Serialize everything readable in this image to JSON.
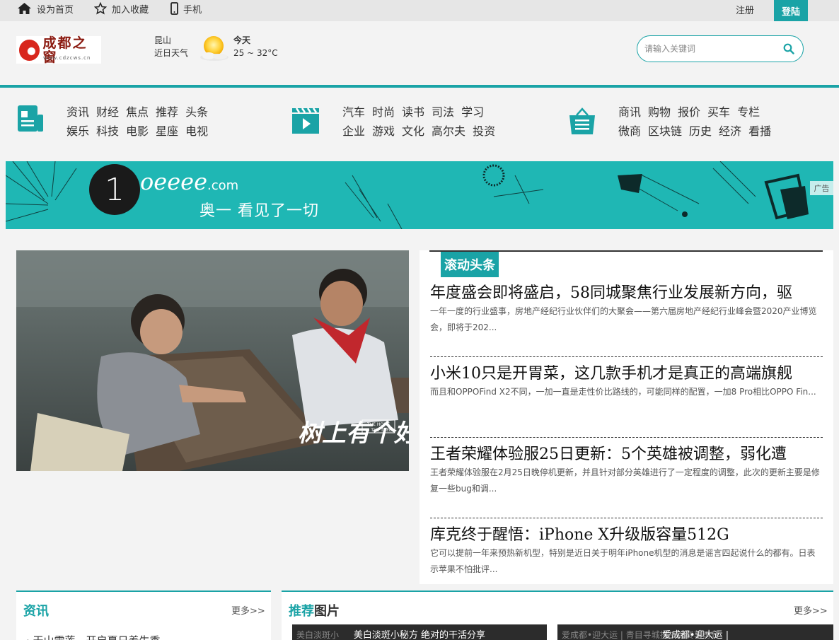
{
  "topbar": {
    "set_home": "设为首页",
    "add_favorite": "加入收藏",
    "mobile": "手机",
    "register": "注册",
    "login": "登陆"
  },
  "header": {
    "logo": {
      "text": "成都之窗",
      "url_text": "www.cdzcws.cn"
    },
    "weather": {
      "city": "昆山",
      "recent_label": "近日天气",
      "day": "今天",
      "temp": "25 ~ 32°C",
      "icon": "sunny-icon"
    },
    "search": {
      "placeholder": "请输入关键词"
    }
  },
  "category_nav": [
    {
      "icon": "news-icon",
      "row1": [
        "资讯",
        "财经",
        "焦点",
        "推荐",
        "头条"
      ],
      "row2": [
        "娱乐",
        "科技",
        "电影",
        "星座",
        "电视"
      ]
    },
    {
      "icon": "video-icon",
      "row1": [
        "汽车",
        "时尚",
        "读书",
        "司法",
        "学习"
      ],
      "row2": [
        "企业",
        "游戏",
        "文化",
        "高尔夫",
        "投资"
      ]
    },
    {
      "icon": "shopping-bag-icon",
      "row1": [
        "商讯",
        "购物",
        "报价",
        "买车",
        "专栏"
      ],
      "row2": [
        "微商",
        "区块链",
        "历史",
        "经济",
        "看播"
      ]
    }
  ],
  "ad_banner": {
    "number": "1",
    "brand": "oeeee",
    "brand_suffix": ".com",
    "slogan": "奥一 看见了一切",
    "tag": "广告"
  },
  "feature": {
    "title_art": "树上有个好地方",
    "title_en": "THE HOME IN THE TREE"
  },
  "headlines": {
    "tab": "滚动头条",
    "items": [
      {
        "title": "年度盛会即将盛启，58同城聚焦行业发展新方向，驱",
        "desc": "一年一度的行业盛事，房地产经纪行业伙伴们的大聚会——第六届房地产经纪行业峰会暨2020产业博览会，即将于202..."
      },
      {
        "title": "小米10只是开胃菜，这几款手机才是真正的高端旗舰",
        "desc": "而且和OPPOFind X2不同，一加一直是走性价比路线的，可能同样的配置，一加8 Pro相比OPPO Fin..."
      },
      {
        "title": "王者荣耀体验服25日更新：5个英雄被调整，弱化遭",
        "desc": "王者荣耀体验服在2月25日晚停机更新，并且针对部分英雄进行了一定程度的调整，此次的更新主要是修复一些bug和调..."
      },
      {
        "title": "库克终于醒悟：iPhone X升级版容量512G",
        "desc": "它可以提前一年来预热新机型，特别是近日关于明年iPhone机型的消息是谣言四起说什么的都有。日表示苹果不怕批评..."
      }
    ]
  },
  "sections": {
    "news": {
      "title": "资讯",
      "more": "更多>>",
      "first_item": "· 天山雪莲，开启夏日养生季"
    },
    "pictures": {
      "title_accent": "推荐",
      "title_rest": "图片",
      "more": "更多>>",
      "items": [
        {
          "caption": "美白淡斑小秘方 绝对的干活分享",
          "alt": "美白淡斑小"
        },
        {
          "caption": "爱成都•迎大运 |",
          "alt": "爱成都•迎大运 | 青目寻城挑战跑赛事再获"
        }
      ]
    }
  }
}
